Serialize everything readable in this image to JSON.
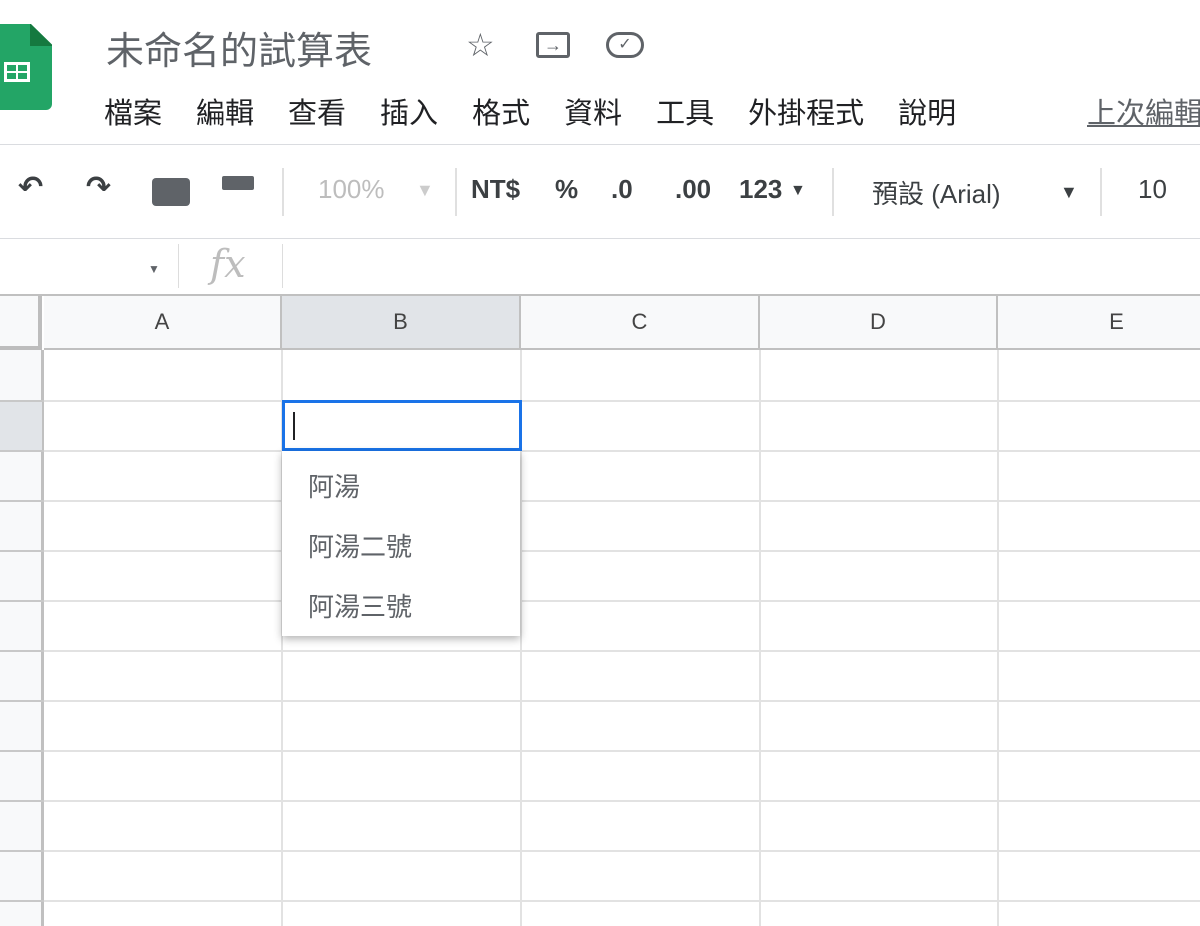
{
  "app": {
    "title": "未命名的試算表",
    "logo": "sheets-logo"
  },
  "title_icons": [
    "star-icon",
    "move-to-folder-icon",
    "cloud-saved-icon"
  ],
  "menu": [
    "檔案",
    "編輯",
    "查看",
    "插入",
    "格式",
    "資料",
    "工具",
    "外掛程式",
    "說明"
  ],
  "last_edit": "上次編輯",
  "toolbar": {
    "zoom": "100%",
    "currency": "NT$",
    "percent": "%",
    "dec_decrease": ".0",
    "dec_increase": ".00",
    "number_format": "123",
    "font": "預設 (Arial)",
    "font_size": "10"
  },
  "formula_bar": {
    "fx": "fx",
    "value": ""
  },
  "columns": [
    "A",
    "B",
    "C",
    "D",
    "E"
  ],
  "selected_cell": "B2",
  "dropdown_options": [
    "阿湯",
    "阿湯二號",
    "阿湯三號"
  ]
}
